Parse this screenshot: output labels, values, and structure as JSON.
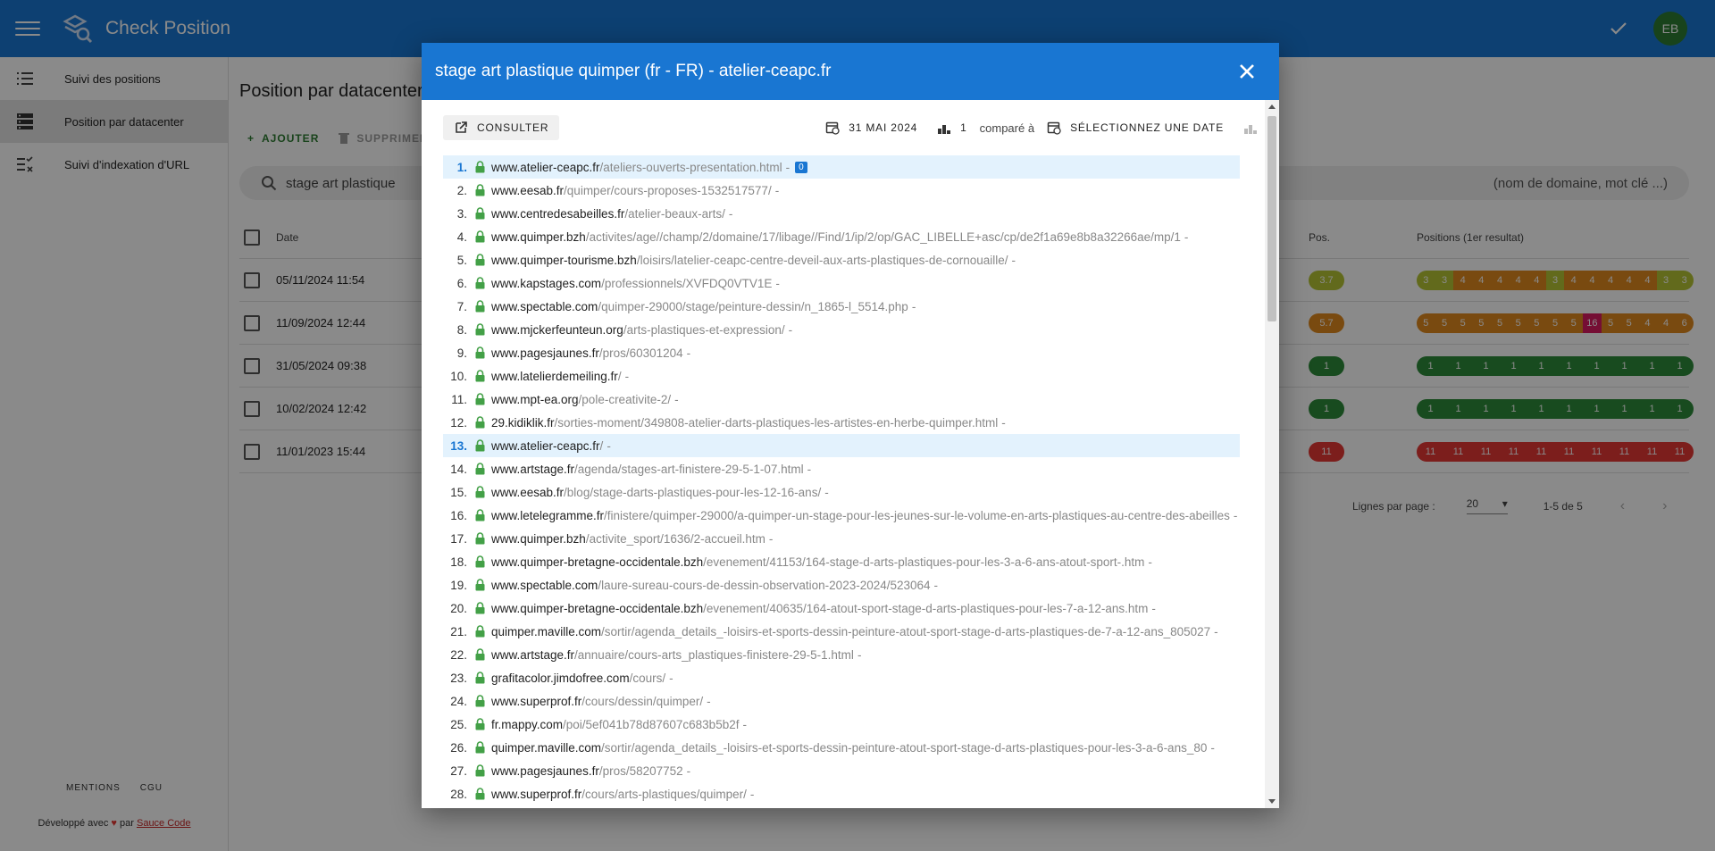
{
  "app": {
    "title": "Check Position",
    "avatar": "EB"
  },
  "sidebar": {
    "items": [
      {
        "label": "Suivi des positions",
        "icon": "list-icon"
      },
      {
        "label": "Position par datacenter",
        "icon": "server-icon"
      },
      {
        "label": "Suivi d'indexation d'URL",
        "icon": "checklist-icon"
      }
    ],
    "footer": {
      "mentions": "MENTIONS",
      "cgu": "CGU",
      "credit_prefix": "Développé avec",
      "credit_by": "par",
      "credit_link": "Sauce Code"
    }
  },
  "main": {
    "title": "Position par datacenter",
    "add_label": "AJOUTER",
    "delete_label": "SUPPRIMER",
    "search_value": "stage art plastique",
    "search_hint": "(nom de domaine, mot clé ...)",
    "columns": {
      "date": "Date",
      "pos": "Pos.",
      "positions": "Positions (1er resultat)"
    },
    "rows": [
      {
        "date": "05/11/2024 11:54",
        "pos": "3.7",
        "pos_color": "#b5c534",
        "strip": [
          [
            "3",
            "#b5c534"
          ],
          [
            "3",
            "#b5c534"
          ],
          [
            "4",
            "#e08a1e"
          ],
          [
            "4",
            "#e08a1e"
          ],
          [
            "4",
            "#e08a1e"
          ],
          [
            "4",
            "#e08a1e"
          ],
          [
            "4",
            "#e08a1e"
          ],
          [
            "3",
            "#b5c534"
          ],
          [
            "4",
            "#e08a1e"
          ],
          [
            "4",
            "#e08a1e"
          ],
          [
            "4",
            "#e08a1e"
          ],
          [
            "4",
            "#e08a1e"
          ],
          [
            "4",
            "#e08a1e"
          ],
          [
            "3",
            "#b5c534"
          ],
          [
            "3",
            "#b5c534"
          ]
        ]
      },
      {
        "date": "11/09/2024 12:44",
        "pos": "5.7",
        "pos_color": "#e08a1e",
        "strip": [
          [
            "5",
            "#e08a1e"
          ],
          [
            "5",
            "#e08a1e"
          ],
          [
            "5",
            "#e08a1e"
          ],
          [
            "5",
            "#e08a1e"
          ],
          [
            "5",
            "#e08a1e"
          ],
          [
            "5",
            "#e08a1e"
          ],
          [
            "5",
            "#e08a1e"
          ],
          [
            "5",
            "#e08a1e"
          ],
          [
            "5",
            "#e08a1e"
          ],
          [
            "16",
            "#d81b60"
          ],
          [
            "5",
            "#e08a1e"
          ],
          [
            "5",
            "#e08a1e"
          ],
          [
            "4",
            "#e08a1e"
          ],
          [
            "4",
            "#e08a1e"
          ],
          [
            "6",
            "#e08a1e"
          ]
        ]
      },
      {
        "date": "31/05/2024 09:38",
        "pos": "1",
        "pos_color": "#2e8b3a",
        "strip": [
          [
            "1",
            "#2e8b3a"
          ],
          [
            "1",
            "#2e8b3a"
          ],
          [
            "1",
            "#2e8b3a"
          ],
          [
            "1",
            "#2e8b3a"
          ],
          [
            "1",
            "#2e8b3a"
          ],
          [
            "1",
            "#2e8b3a"
          ],
          [
            "1",
            "#2e8b3a"
          ],
          [
            "1",
            "#2e8b3a"
          ],
          [
            "1",
            "#2e8b3a"
          ],
          [
            "1",
            "#2e8b3a"
          ]
        ]
      },
      {
        "date": "10/02/2024 12:42",
        "pos": "1",
        "pos_color": "#2e8b3a",
        "strip": [
          [
            "1",
            "#2e8b3a"
          ],
          [
            "1",
            "#2e8b3a"
          ],
          [
            "1",
            "#2e8b3a"
          ],
          [
            "1",
            "#2e8b3a"
          ],
          [
            "1",
            "#2e8b3a"
          ],
          [
            "1",
            "#2e8b3a"
          ],
          [
            "1",
            "#2e8b3a"
          ],
          [
            "1",
            "#2e8b3a"
          ],
          [
            "1",
            "#2e8b3a"
          ],
          [
            "1",
            "#2e8b3a"
          ]
        ]
      },
      {
        "date": "11/01/2023 15:44",
        "pos": "11",
        "pos_color": "#e53935",
        "strip": [
          [
            "11",
            "#e53935"
          ],
          [
            "11",
            "#e53935"
          ],
          [
            "11",
            "#e53935"
          ],
          [
            "11",
            "#e53935"
          ],
          [
            "11",
            "#e53935"
          ],
          [
            "11",
            "#e53935"
          ],
          [
            "11",
            "#e53935"
          ],
          [
            "11",
            "#e53935"
          ],
          [
            "11",
            "#e53935"
          ],
          [
            "11",
            "#e53935"
          ]
        ]
      }
    ],
    "pager": {
      "label": "Lignes par page :",
      "per_page": "20",
      "range": "1-5 de 5"
    }
  },
  "dialog": {
    "title": "stage art plastique quimper (fr - FR) - atelier-ceapc.fr",
    "consult_label": "CONSULTER",
    "date_label": "31 MAI 2024",
    "position_value": "1",
    "compare_label": "comparé à",
    "select_date_label": "SÉLECTIONNEZ UNE DATE",
    "results": [
      {
        "n": "1.",
        "domain": "www.atelier-ceapc.fr",
        "path": "/ateliers-ouverts-presentation.html",
        "hl": true,
        "badge": "0"
      },
      {
        "n": "2.",
        "domain": "www.eesab.fr",
        "path": "/quimper/cours-proposes-1532517577/"
      },
      {
        "n": "3.",
        "domain": "www.centredesabeilles.fr",
        "path": "/atelier-beaux-arts/"
      },
      {
        "n": "4.",
        "domain": "www.quimper.bzh",
        "path": "/activites/age//champ/2/domaine/17/libage//Find/1/ip/2/op/GAC_LIBELLE+asc/cp/de2f1a69e8b8a32266ae/mp/1"
      },
      {
        "n": "5.",
        "domain": "www.quimper-tourisme.bzh",
        "path": "/loisirs/latelier-ceapc-centre-deveil-aux-arts-plastiques-de-cornouaille/"
      },
      {
        "n": "6.",
        "domain": "www.kapstages.com",
        "path": "/professionnels/XVFDQ0VTV1E"
      },
      {
        "n": "7.",
        "domain": "www.spectable.com",
        "path": "/quimper-29000/stage/peinture-dessin/n_1865-l_5514.php"
      },
      {
        "n": "8.",
        "domain": "www.mjckerfeunteun.org",
        "path": "/arts-plastiques-et-expression/"
      },
      {
        "n": "9.",
        "domain": "www.pagesjaunes.fr",
        "path": "/pros/60301204"
      },
      {
        "n": "10.",
        "domain": "www.latelierdemeiling.fr",
        "path": "/"
      },
      {
        "n": "11.",
        "domain": "www.mpt-ea.org",
        "path": "/pole-creativite-2/"
      },
      {
        "n": "12.",
        "domain": "29.kidiklik.fr",
        "path": "/sorties-moment/349808-atelier-darts-plastiques-les-artistes-en-herbe-quimper.html"
      },
      {
        "n": "13.",
        "domain": "www.atelier-ceapc.fr",
        "path": "/",
        "hl": true
      },
      {
        "n": "14.",
        "domain": "www.artstage.fr",
        "path": "/agenda/stages-art-finistere-29-5-1-07.html"
      },
      {
        "n": "15.",
        "domain": "www.eesab.fr",
        "path": "/blog/stage-darts-plastiques-pour-les-12-16-ans/"
      },
      {
        "n": "16.",
        "domain": "www.letelegramme.fr",
        "path": "/finistere/quimper-29000/a-quimper-un-stage-pour-les-jeunes-sur-le-volume-en-arts-plastiques-au-centre-des-abeilles"
      },
      {
        "n": "17.",
        "domain": "www.quimper.bzh",
        "path": "/activite_sport/1636/2-accueil.htm"
      },
      {
        "n": "18.",
        "domain": "www.quimper-bretagne-occidentale.bzh",
        "path": "/evenement/41153/164-stage-d-arts-plastiques-pour-les-3-a-6-ans-atout-sport-.htm"
      },
      {
        "n": "19.",
        "domain": "www.spectable.com",
        "path": "/laure-sureau-cours-de-dessin-observation-2023-2024/523064"
      },
      {
        "n": "20.",
        "domain": "www.quimper-bretagne-occidentale.bzh",
        "path": "/evenement/40635/164-atout-sport-stage-d-arts-plastiques-pour-les-7-a-12-ans.htm"
      },
      {
        "n": "21.",
        "domain": "quimper.maville.com",
        "path": "/sortir/agenda_details_-loisirs-et-sports-dessin-peinture-atout-sport-stage-d-arts-plastiques-de-7-a-12-ans_805027"
      },
      {
        "n": "22.",
        "domain": "www.artstage.fr",
        "path": "/annuaire/cours-arts_plastiques-finistere-29-5-1.html"
      },
      {
        "n": "23.",
        "domain": "grafitacolor.jimdofree.com",
        "path": "/cours/"
      },
      {
        "n": "24.",
        "domain": "www.superprof.fr",
        "path": "/cours/dessin/quimper/"
      },
      {
        "n": "25.",
        "domain": "fr.mappy.com",
        "path": "/poi/5ef041b78d87607c683b5b2f"
      },
      {
        "n": "26.",
        "domain": "quimper.maville.com",
        "path": "/sortir/agenda_details_-loisirs-et-sports-dessin-peinture-atout-sport-stage-d-arts-plastiques-pour-les-3-a-6-ans_80"
      },
      {
        "n": "27.",
        "domain": "www.pagesjaunes.fr",
        "path": "/pros/58207752"
      },
      {
        "n": "28.",
        "domain": "www.superprof.fr",
        "path": "/cours/arts-plastiques/quimper/"
      }
    ]
  }
}
